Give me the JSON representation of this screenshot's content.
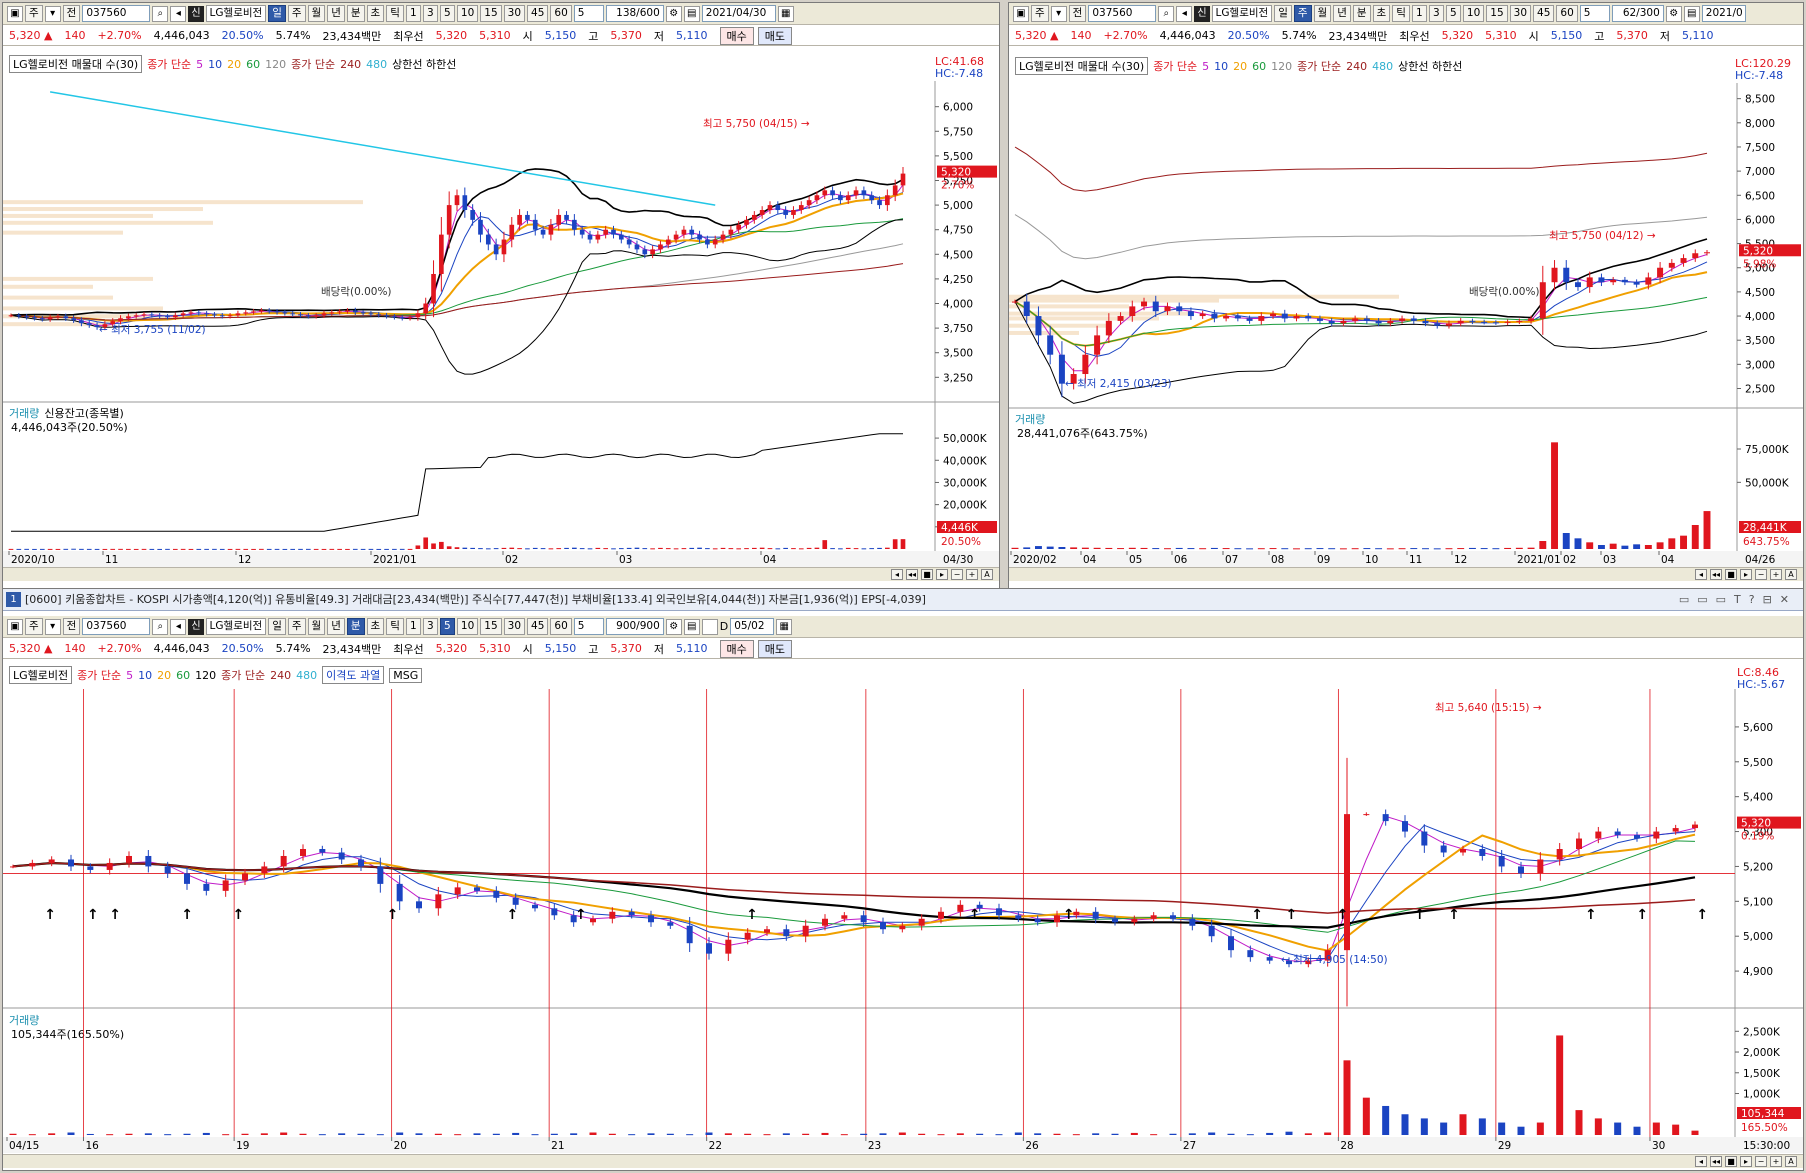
{
  "toolbar_common": {
    "type_label": "주",
    "prev_label": "전",
    "code": "037560",
    "tag": "신",
    "name": "LG헬로비전",
    "periods": [
      "일",
      "주",
      "월",
      "년",
      "분",
      "초",
      "틱"
    ],
    "nums": [
      "1",
      "3",
      "5",
      "10",
      "15",
      "30",
      "45",
      "60"
    ],
    "sel": "5"
  },
  "quote": {
    "price": "5,320",
    "arrow": "▲",
    "change": "140",
    "pct": "+2.70%",
    "volume": "4,446,043",
    "ratio1": "20.50%",
    "ratio2": "5.74%",
    "amount": "23,434백만",
    "best_label": "최우선",
    "best_ask": "5,320",
    "best_bid": "5,310",
    "open_label": "시",
    "open": "5,150",
    "high_label": "고",
    "high": "5,370",
    "low_label": "저",
    "low": "5,110",
    "buy": "매수",
    "sell": "매도"
  },
  "panel1": {
    "count": "138/600",
    "date": "2021/04/30",
    "legend": {
      "name": "LG헬로비전 매물대 수(30)",
      "ma_label": "종가 단순",
      "ma_periods": [
        "5",
        "10",
        "20",
        "60",
        "120"
      ],
      "ma2_label": "종가 단순",
      "ma2_periods": [
        "240",
        "480"
      ],
      "bands": "상한선 하한선"
    },
    "lc": "LC:41.68",
    "hc": "HC:-7.48",
    "price_box": "5,320",
    "pct_box": "2.70%",
    "high_note": "최고 5,750 (04/15)",
    "low_note": "최저 3,755 (11/02)",
    "div_note": "배당락(0.00%)",
    "vol_legend": "거래량",
    "credit_legend": "신용잔고(종목별)",
    "vol_value": "4,446,043주(20.50%)",
    "vol_box": "4,446K",
    "vol_pct_box": "20.50%",
    "end_date": "04/30"
  },
  "panel2": {
    "count": "62/300",
    "date": "2021/0",
    "legend": {
      "name": "LG헬로비전 매물대 수(30)",
      "ma_label": "종가 단순",
      "ma_periods": [
        "5",
        "10",
        "20",
        "60",
        "120"
      ],
      "ma2_label": "종가 단순",
      "ma2_periods": [
        "240",
        "480"
      ],
      "bands": "상한선 하한선"
    },
    "lc": "LC:120.29",
    "hc": "HC:-7.48",
    "price_box": "5,320",
    "pct_box": "5.98%",
    "high_note": "최고 5,750 (04/12)",
    "low_note": "최저 2,415 (03/23)",
    "div_note": "배당락(0.00%)",
    "vol_legend": "거래량",
    "vol_value": "28,441,076주(643.75%)",
    "vol_box": "28,441K",
    "vol_pct_box": "643.75%",
    "end_date": "04/26"
  },
  "panel3": {
    "window_title": "[0600] 키움종합차트 - KOSPI 시가총액[4,120(억)] 유통비율[49.3] 거래대금[23,434(백만)] 주식수[77,447(천)] 부채비율[133.4] 외국인보유[4,044(천)] 자본금[1,936(억)] EPS[-4,039]",
    "window_no": "1",
    "count": "900/900",
    "date": "05/02",
    "check_label": "D",
    "legend": {
      "name": "LG헬로비전",
      "ma_label": "종가 단순",
      "ma_periods": [
        "5",
        "10",
        "20",
        "60",
        "120"
      ],
      "ma2_label": "종가 단순",
      "ma2_periods": [
        "240",
        "480"
      ],
      "disparity": "이격도 과열",
      "msg": "MSG"
    },
    "lc": "LC:8.46",
    "hc": "HC:-5.67",
    "price_box": "5,320",
    "pct_box": "0.19%",
    "high_note": "최고 5,640 (15:15)",
    "low_note": "최저 4,905 (14:50)",
    "vol_legend": "거래량",
    "vol_value": "105,344주(165.50%)",
    "vol_box": "105,344",
    "vol_pct_box": "165.50%",
    "end_time": "15:30:00"
  },
  "chart_data": [
    {
      "type": "candlestick",
      "title": "LG헬로비전 일봉",
      "y_ticks": [
        3250,
        3500,
        3750,
        4000,
        4250,
        4500,
        4750,
        5000,
        5250,
        5500,
        5750,
        6000
      ],
      "ylim": [
        3050,
        6200
      ],
      "x_ticks": [
        "2020/10",
        "11",
        "12",
        "2021/01",
        "02",
        "03",
        "04"
      ],
      "close_series": [
        3880,
        3870,
        3860,
        3850,
        3840,
        3860,
        3870,
        3850,
        3830,
        3800,
        3780,
        3760,
        3790,
        3820,
        3850,
        3870,
        3880,
        3890,
        3880,
        3870,
        3860,
        3880,
        3900,
        3910,
        3900,
        3890,
        3880,
        3870,
        3880,
        3900,
        3910,
        3920,
        3930,
        3920,
        3910,
        3900,
        3890,
        3880,
        3870,
        3880,
        3900,
        3910,
        3920,
        3930,
        3910,
        3900,
        3890,
        3880,
        3870,
        3860,
        3850,
        3860,
        3900,
        4000,
        4300,
        4700,
        5000,
        5100,
        4950,
        4850,
        4700,
        4600,
        4500,
        4650,
        4800,
        4900,
        4850,
        4750,
        4700,
        4800,
        4900,
        4850,
        4750,
        4700,
        4650,
        4700,
        4750,
        4700,
        4650,
        4600,
        4550,
        4500,
        4550,
        4600,
        4650,
        4700,
        4750,
        4700,
        4650,
        4600,
        4650,
        4700,
        4750,
        4800,
        4850,
        4900,
        4950,
        5000,
        4950,
        4900,
        4950,
        5000,
        5050,
        5100,
        5150,
        5100,
        5050,
        5100,
        5150,
        5100,
        5050,
        5000,
        5100,
        5200,
        5320
      ],
      "series": [
        {
          "name": "거래량",
          "unit": "K",
          "values": [
            50,
            40,
            60,
            30,
            50,
            40,
            30,
            70,
            120,
            60,
            50,
            40,
            30,
            50,
            60,
            40,
            30,
            50,
            40,
            30,
            60,
            40,
            50,
            30,
            40,
            50,
            60,
            40,
            30,
            50,
            40,
            30,
            60,
            40,
            50,
            30,
            40,
            50,
            60,
            40,
            30,
            50,
            40,
            30,
            60,
            40,
            50,
            30,
            40,
            50,
            60,
            40,
            1600,
            5200,
            2500,
            3200,
            1200,
            800,
            600,
            500,
            400,
            300,
            400,
            500,
            600,
            400,
            300,
            500,
            400,
            300,
            400,
            500,
            600,
            400,
            300,
            500,
            400,
            300,
            400,
            500,
            600,
            400,
            300,
            500,
            400,
            300,
            400,
            500,
            600,
            400,
            300,
            500,
            400,
            300,
            400,
            500,
            600,
            400,
            300,
            500,
            400,
            300,
            500,
            600,
            4000,
            400,
            300,
            500,
            400,
            300,
            400,
            500,
            600,
            4400,
            4446
          ]
        }
      ],
      "y2_ticks": [
        "10,000K",
        "20,000K",
        "30,000K",
        "40,000K",
        "50,000K"
      ],
      "y2lim": [
        0,
        55000
      ]
    },
    {
      "type": "candlestick",
      "title": "LG헬로비전 주봉",
      "y_ticks": [
        2500,
        3000,
        3500,
        4000,
        4500,
        5000,
        5500,
        6000,
        6500,
        7000,
        7500,
        8000,
        8500
      ],
      "ylim": [
        2200,
        8700
      ],
      "x_ticks": [
        "2020/02",
        "04",
        "05",
        "06",
        "07",
        "08",
        "09",
        "10",
        "11",
        "12",
        "2021/01",
        "02",
        "03",
        "04"
      ],
      "close_series": [
        4300,
        4000,
        3600,
        3200,
        2600,
        2800,
        3200,
        3600,
        3900,
        4000,
        4200,
        4300,
        4100,
        4200,
        4100,
        4000,
        4050,
        3950,
        4000,
        3950,
        3900,
        4000,
        4050,
        3950,
        4000,
        3950,
        3900,
        3850,
        3900,
        3950,
        3900,
        3850,
        3900,
        3950,
        3900,
        3850,
        3800,
        3850,
        3900,
        3880,
        3870,
        3860,
        3880,
        3900,
        3950,
        4700,
        5000,
        4700,
        4600,
        4800,
        4700,
        4750,
        4700,
        4650,
        4800,
        5000,
        5100,
        5200,
        5300,
        5320
      ],
      "series": [
        {
          "name": "거래량",
          "unit": "K",
          "values": [
            900,
            1200,
            2200,
            1800,
            1500,
            1200,
            1000,
            900,
            800,
            700,
            900,
            800,
            700,
            600,
            800,
            700,
            600,
            800,
            700,
            600,
            500,
            600,
            700,
            600,
            500,
            600,
            700,
            600,
            500,
            600,
            700,
            600,
            500,
            600,
            700,
            600,
            500,
            600,
            700,
            800,
            700,
            600,
            800,
            900,
            1000,
            6000,
            80000,
            12000,
            8000,
            5000,
            3000,
            4000,
            2500,
            3500,
            3000,
            5000,
            8000,
            10000,
            18000,
            28441
          ]
        }
      ],
      "y2_ticks": [
        "50,000K",
        "75,000K"
      ],
      "y2lim": [
        0,
        90000
      ]
    },
    {
      "type": "candlestick",
      "title": "LG헬로비전 5분봉",
      "y_ticks": [
        4900,
        5000,
        5100,
        5200,
        5300,
        5400,
        5500,
        5600
      ],
      "ylim": [
        4820,
        5680
      ],
      "x_ticks": [
        "04/15",
        "16",
        "19",
        "20",
        "21",
        "22",
        "23",
        "26",
        "27",
        "28",
        "29",
        "30"
      ],
      "close_series": [
        5200,
        5210,
        5220,
        5200,
        5190,
        5210,
        5230,
        5200,
        5180,
        5150,
        5130,
        5160,
        5180,
        5200,
        5230,
        5250,
        5240,
        5220,
        5200,
        5150,
        5100,
        5080,
        5120,
        5140,
        5130,
        5110,
        5090,
        5080,
        5060,
        5040,
        5050,
        5070,
        5060,
        5040,
        5030,
        4980,
        4950,
        4990,
        5010,
        5020,
        5000,
        5030,
        5050,
        5060,
        5040,
        5020,
        5030,
        5050,
        5070,
        5090,
        5080,
        5060,
        5050,
        5040,
        5060,
        5070,
        5050,
        5040,
        5050,
        5060,
        5050,
        5030,
        5000,
        4960,
        4940,
        4930,
        4920,
        4930,
        4960,
        5350,
        5350,
        5330,
        5300,
        5260,
        5240,
        5250,
        5230,
        5200,
        5180,
        5220,
        5250,
        5280,
        5300,
        5290,
        5280,
        5300,
        5310,
        5320
      ],
      "series": [
        {
          "name": "거래량",
          "values": [
            30,
            20,
            40,
            60,
            25,
            20,
            30,
            40,
            20,
            30,
            50,
            20,
            30,
            40,
            60,
            30,
            20,
            40,
            30,
            20,
            60,
            40,
            30,
            20,
            40,
            30,
            50,
            20,
            30,
            40,
            60,
            30,
            20,
            40,
            30,
            20,
            60,
            40,
            30,
            20,
            40,
            30,
            50,
            20,
            30,
            40,
            60,
            30,
            20,
            40,
            30,
            20,
            60,
            40,
            30,
            20,
            40,
            30,
            50,
            20,
            30,
            40,
            60,
            30,
            20,
            50,
            80,
            40,
            60,
            1800,
            900,
            700,
            500,
            400,
            300,
            500,
            400,
            300,
            200,
            300,
            2400,
            600,
            400,
            300,
            200,
            300,
            250,
            105
          ]
        }
      ],
      "y2_ticks": [
        "1,000K",
        "1,500K",
        "2,000K",
        "2,500K"
      ],
      "y2lim": [
        0,
        2700
      ]
    }
  ]
}
